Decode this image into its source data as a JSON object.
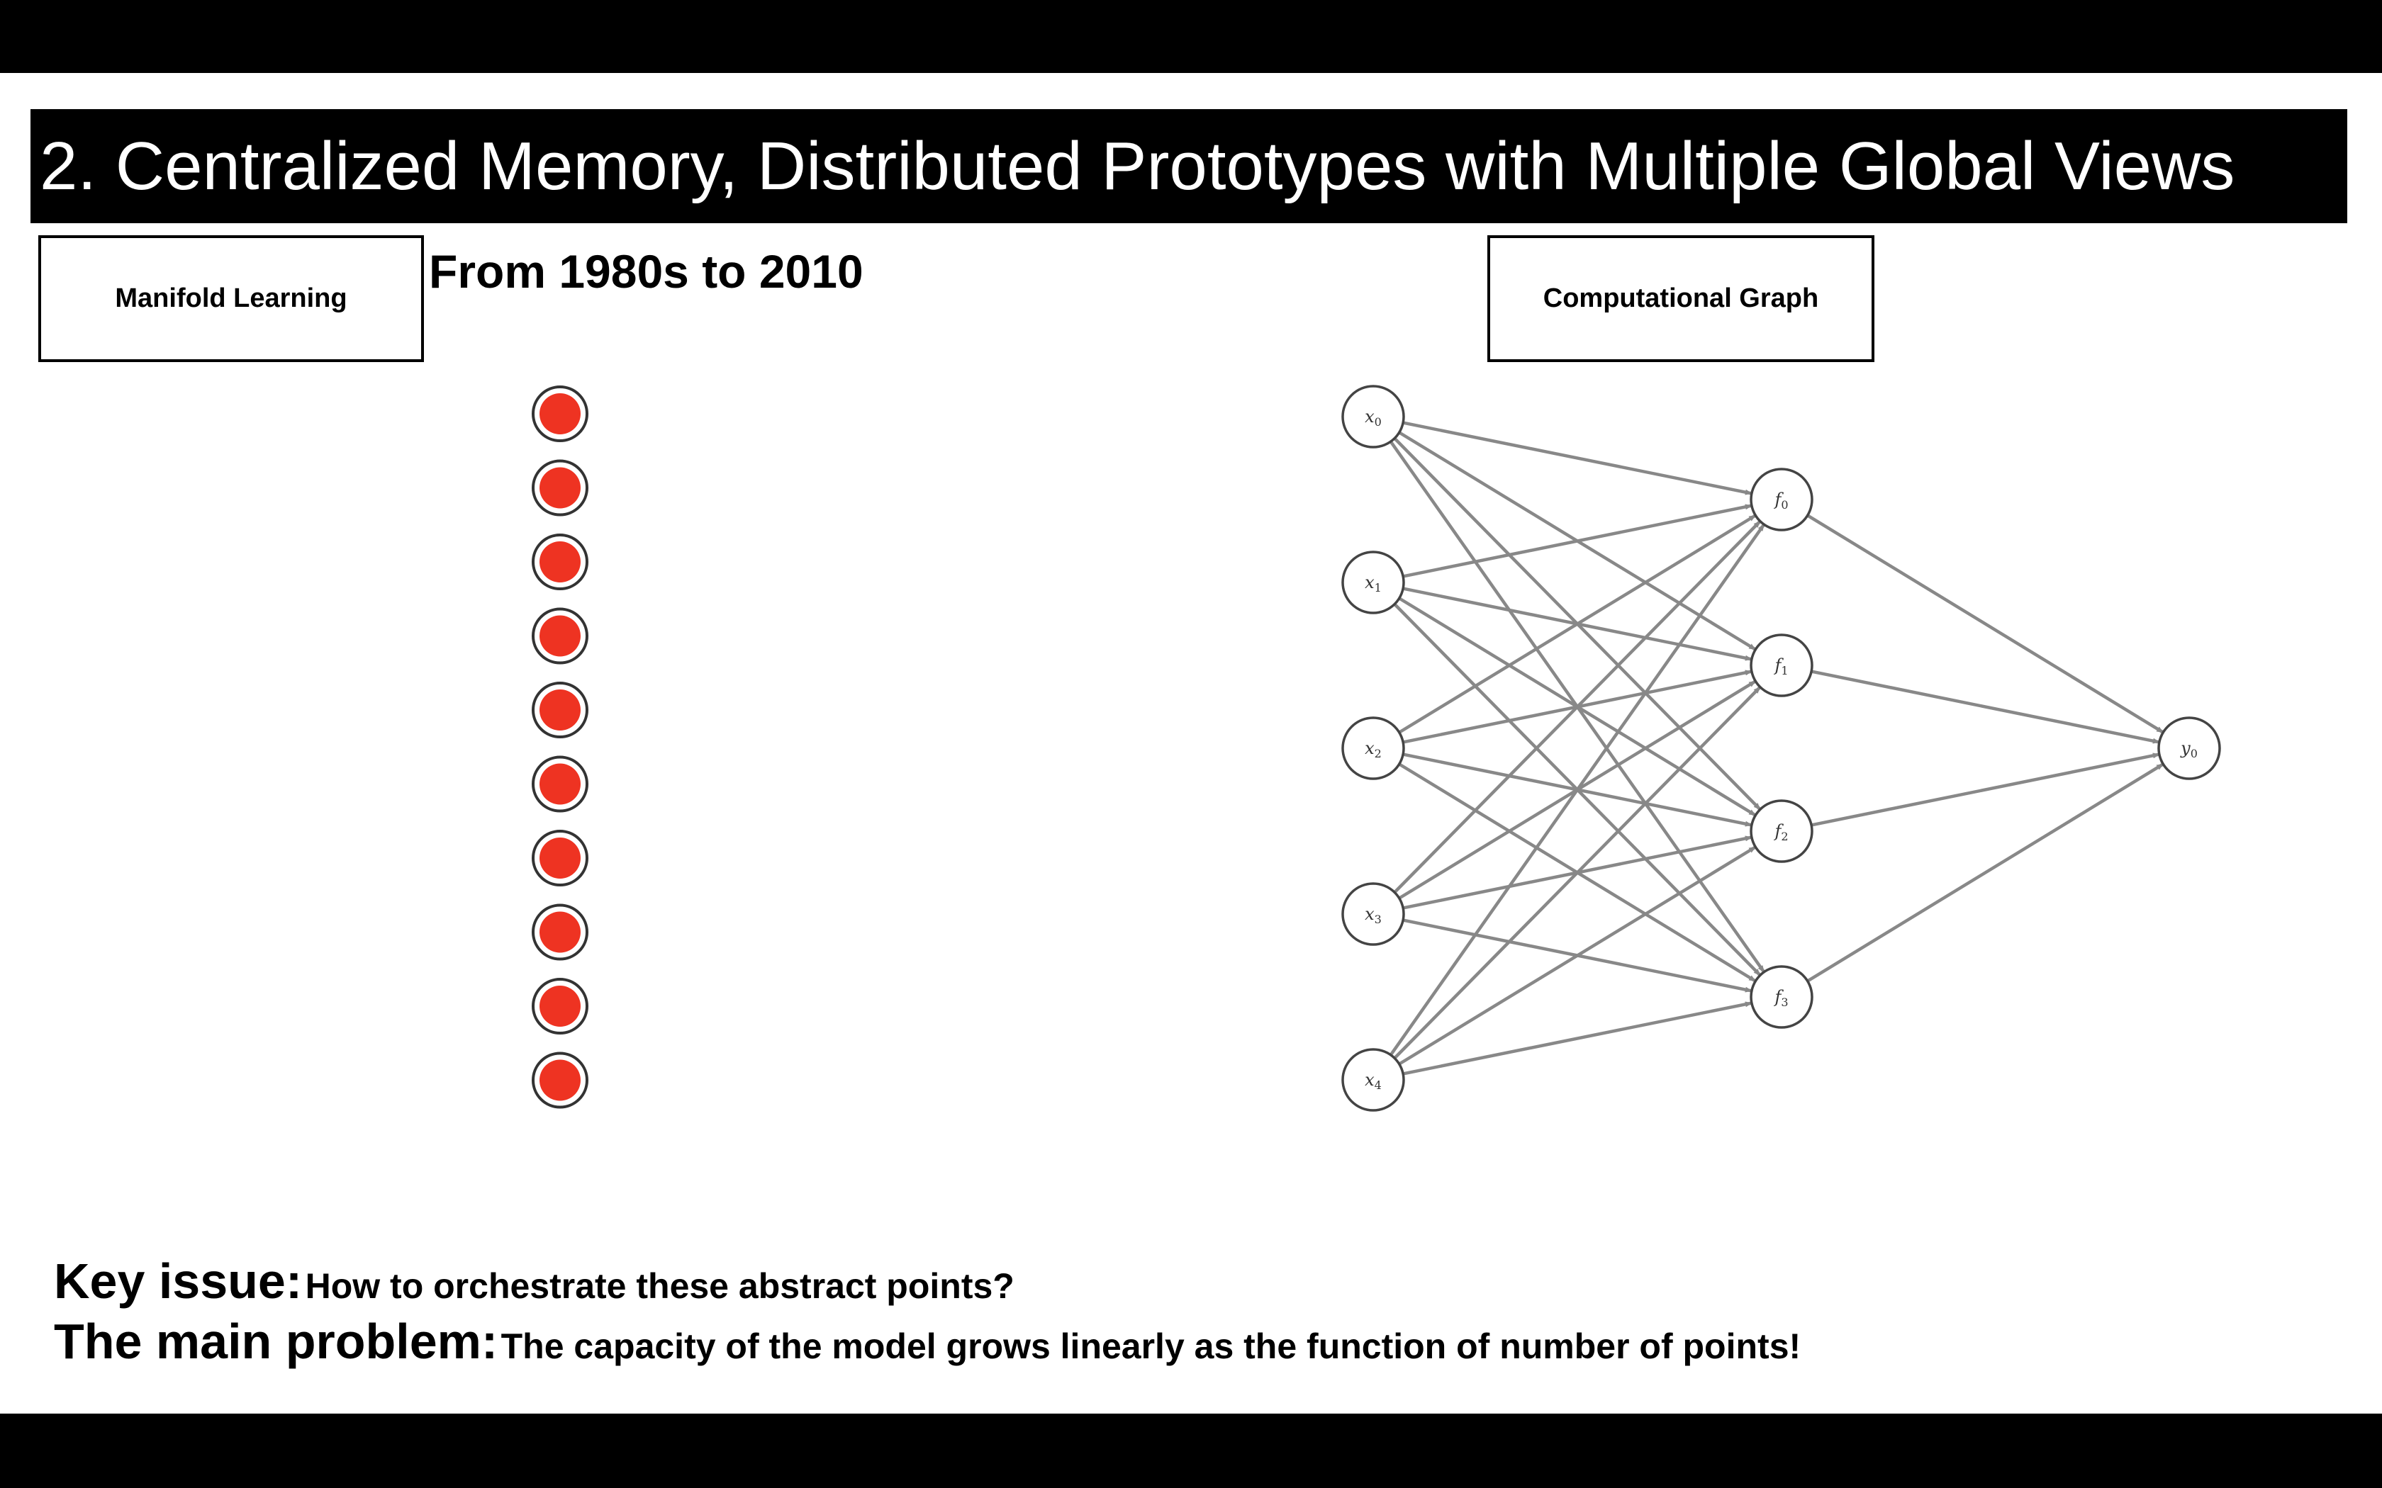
{
  "slide": {
    "title": "2. Centralized Memory, Distributed Prototypes with Multiple Global Views",
    "era": "From 1980s to 2010",
    "manifold_label": "Manifold Learning",
    "graph_label": "Computational Graph",
    "key_issue_label": "Key issue:",
    "key_issue_text": "How to orchestrate these abstract points?",
    "main_problem_label": "The main problem:",
    "main_problem_text": "The capacity of the model grows linearly as the function of number of points!"
  },
  "memory_points": {
    "count": 10,
    "fill_color": "#ee3322",
    "ring_color": "#333333"
  },
  "graph": {
    "inputs": [
      {
        "var": "x",
        "sub": "0"
      },
      {
        "var": "x",
        "sub": "1"
      },
      {
        "var": "x",
        "sub": "2"
      },
      {
        "var": "x",
        "sub": "3"
      },
      {
        "var": "x",
        "sub": "4"
      }
    ],
    "hidden": [
      {
        "var": "f",
        "sub": "0"
      },
      {
        "var": "f",
        "sub": "1"
      },
      {
        "var": "f",
        "sub": "2"
      },
      {
        "var": "f",
        "sub": "3"
      }
    ],
    "outputs": [
      {
        "var": "y",
        "sub": "0"
      }
    ],
    "edge_color": "#888888",
    "node_stroke": "#444444"
  },
  "colors": {
    "band": "#000000",
    "title_text": "#ffffff"
  }
}
